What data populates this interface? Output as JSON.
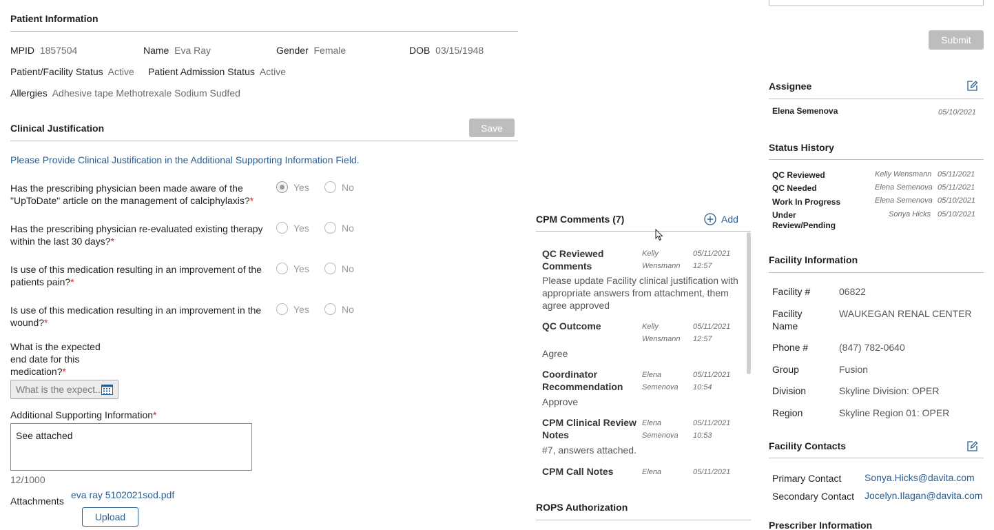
{
  "patient": {
    "title": "Patient Information",
    "mpid_label": "MPID",
    "mpid": "1857504",
    "name_label": "Name",
    "name": "Eva Ray",
    "gender_label": "Gender",
    "gender": "Female",
    "dob_label": "DOB",
    "dob": "03/15/1948",
    "facility_status_label": "Patient/Facility Status",
    "facility_status": "Active",
    "admission_status_label": "Patient Admission Status",
    "admission_status": "Active",
    "allergies_label": "Allergies",
    "allergies": "Adhesive tape Methotrexale Sodium Sudfed"
  },
  "clinical": {
    "title": "Clinical Justification",
    "save_label": "Save",
    "instruction": "Please Provide Clinical Justification in the Additional Supporting Information Field.",
    "yes_label": "Yes",
    "no_label": "No",
    "req_mark": "*",
    "questions": [
      {
        "l1": "Has the prescribing physician been made aware of the",
        "l2": "\"UpToDate\" article on the management of calciphylaxis?",
        "answer": "yes"
      },
      {
        "l1": "Has the prescribing physician re-evaluated existing therapy",
        "l2": "within the last 30 days?",
        "answer": ""
      },
      {
        "l1": "Is use of this medication resulting in an improvement of the",
        "l2": "patients pain?",
        "answer": ""
      },
      {
        "l1": "Is use of this medication resulting in an improvement in the",
        "l2": "wound?",
        "answer": ""
      }
    ],
    "end_date_q": [
      "What is the expected",
      "end date for this",
      "medication?"
    ],
    "end_date_placeholder": "What is the expect...",
    "additional_label": "Additional Supporting Information",
    "additional_value": "See attached",
    "char_count": "12/1000",
    "attachments_label": "Attachments",
    "attachment_file": "eva ray 5102021sod.pdf",
    "upload_label": "Upload"
  },
  "comments": {
    "title": "CPM Comments (7)",
    "add_label": "Add",
    "items": [
      {
        "t1": "QC Reviewed",
        "t2": "Comments",
        "u1": "Kelly",
        "u2": "Wensmann",
        "d": "05/11/2021",
        "tm": "12:57",
        "text": [
          "Please update Facility clinical justification with",
          "appropriate answers from attachment, them",
          "agree approved"
        ]
      },
      {
        "t1": "QC Outcome",
        "t2": "",
        "u1": "Kelly",
        "u2": "Wensmann",
        "d": "05/11/2021",
        "tm": "12:57",
        "text": [
          "Agree"
        ]
      },
      {
        "t1": "Coordinator",
        "t2": "Recommendation",
        "u1": "Elena",
        "u2": "Semenova",
        "d": "05/11/2021",
        "tm": "10:54",
        "text": [
          "Approve"
        ]
      },
      {
        "t1": "CPM Clinical Review",
        "t2": "Notes",
        "u1": "Elena",
        "u2": "Semenova",
        "d": "05/11/2021",
        "tm": "10:53",
        "text": [
          "#7, answers attached."
        ]
      },
      {
        "t1": "CPM Call Notes",
        "t2": "",
        "u1": "Elena",
        "u2": "",
        "d": "05/11/2021",
        "tm": "",
        "text": []
      }
    ]
  },
  "rops": {
    "title": "ROPS Authorization"
  },
  "right": {
    "submit_label": "Submit",
    "assignee_title": "Assignee",
    "assignee_name": "Elena Semenova",
    "assignee_date": "05/10/2021",
    "status_title": "Status History",
    "status": [
      {
        "s1": "QC Reviewed",
        "s2": "",
        "user": "Kelly Wensmann",
        "date": "05/11/2021"
      },
      {
        "s1": "QC Needed",
        "s2": "",
        "user": "Elena Semenova",
        "date": "05/11/2021"
      },
      {
        "s1": "Work In Progress",
        "s2": "",
        "user": "Elena Semenova",
        "date": "05/10/2021"
      },
      {
        "s1": "Under",
        "s2": "Review/Pending",
        "user": "Sonya Hicks",
        "date": "05/10/2021"
      }
    ],
    "facility_title": "Facility Information",
    "facility": [
      {
        "l1": "Facility #",
        "l2": "",
        "v": "06822"
      },
      {
        "l1": "Facility",
        "l2": "Name",
        "v": "WAUKEGAN RENAL CENTER"
      },
      {
        "l1": "Phone #",
        "l2": "",
        "v": "(847) 782-0640"
      },
      {
        "l1": "Group",
        "l2": "",
        "v": "Fusion"
      },
      {
        "l1": "Division",
        "l2": "",
        "v": "Skyline Division: OPER"
      },
      {
        "l1": "Region",
        "l2": "",
        "v": "Skyline Region 01: OPER"
      }
    ],
    "contacts_title": "Facility Contacts",
    "primary_label": "Primary Contact",
    "primary_email": "Sonya.Hicks@davita.com",
    "secondary_label": "Secondary Contact",
    "secondary_email": "Jocelyn.Ilagan@davita.com",
    "prescriber_title": "Prescriber Information"
  }
}
